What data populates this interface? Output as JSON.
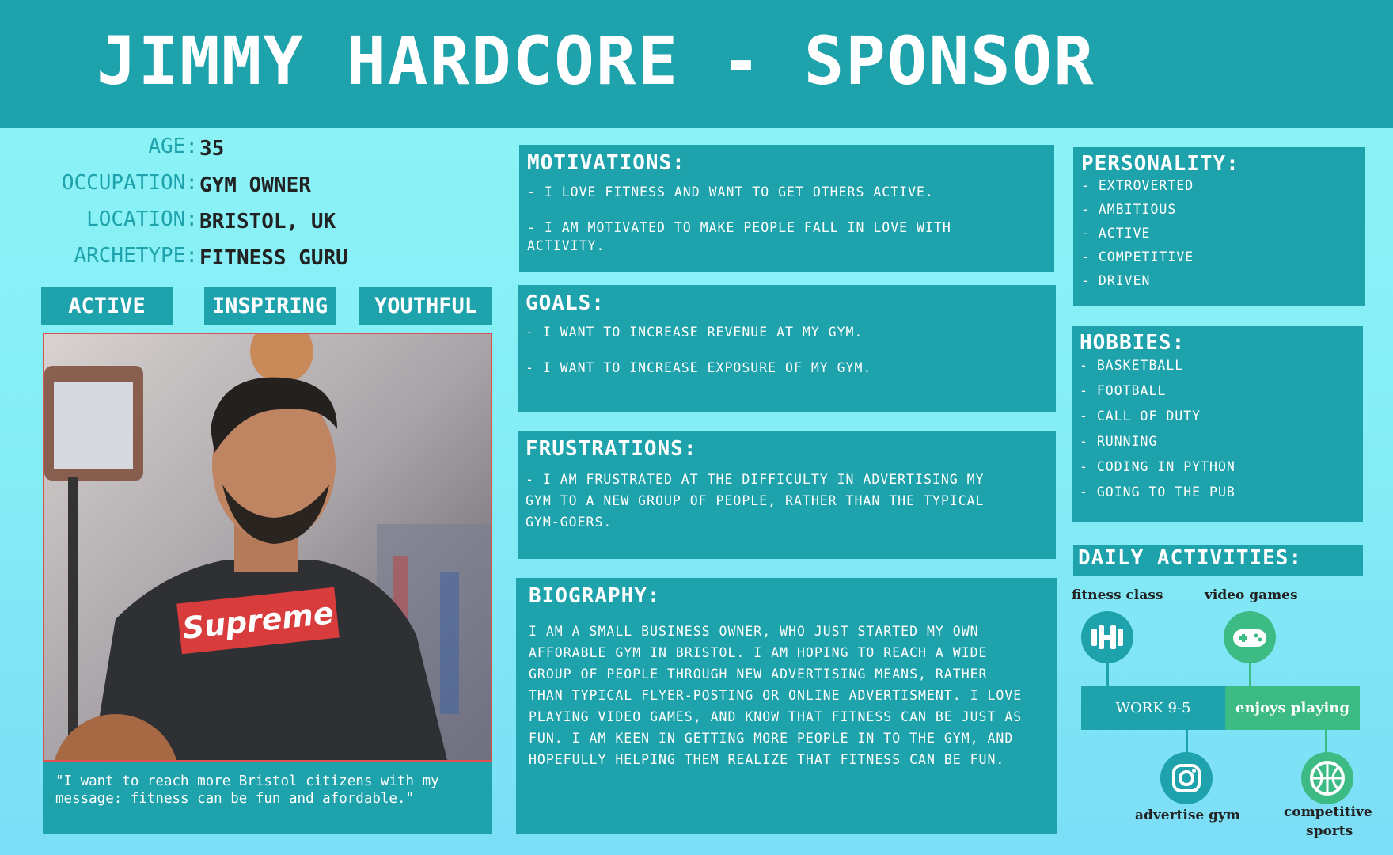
{
  "header": {
    "title": "JIMMY HARDCORE - SPONSOR"
  },
  "demographics": [
    {
      "key": "AGE:",
      "value": "35"
    },
    {
      "key": "OCCUPATION:",
      "value": "GYM OWNER"
    },
    {
      "key": "LOCATION:",
      "value": "BRISTOL, UK"
    },
    {
      "key": "ARCHETYPE:",
      "value": "FITNESS GURU"
    }
  ],
  "traits": [
    "ACTIVE",
    "INSPIRING",
    "YOUTHFUL"
  ],
  "photo": {
    "shirt_text": "Supreme"
  },
  "quote": "\"I want to reach more Bristol citizens with my message: fitness can be fun and afordable.\"",
  "motivations": {
    "title": "MOTIVATIONS:",
    "items": [
      "- I LOVE FITNESS AND WANT TO GET OTHERS ACTIVE.",
      "- I AM MOTIVATED TO MAKE PEOPLE FALL IN LOVE WITH ACTIVITY."
    ]
  },
  "goals": {
    "title": "GOALS:",
    "items": [
      "- I WANT TO INCREASE REVENUE AT MY GYM.",
      "- I WANT TO INCREASE EXPOSURE OF MY GYM."
    ]
  },
  "frustrations": {
    "title": "FRUSTRATIONS:",
    "text": "- I AM FRUSTRATED AT THE DIFFICULTY IN ADVERTISING MY GYM TO A NEW GROUP OF PEOPLE, RATHER THAN THE TYPICAL GYM-GOERS."
  },
  "biography": {
    "title": "BIOGRAPHY:",
    "text": "I AM A SMALL BUSINESS OWNER, WHO JUST STARTED MY OWN AFFORABLE GYM IN BRISTOL. I AM HOPING TO REACH A WIDE GROUP OF PEOPLE THROUGH NEW ADVERTISING MEANS, RATHER THAN TYPICAL FLYER-POSTING OR ONLINE ADVERTISMENT. I LOVE PLAYING VIDEO GAMES, AND KNOW THAT FITNESS CAN BE JUST AS FUN. I AM KEEN IN GETTING MORE PEOPLE IN TO THE GYM, AND HOPEFULLY HELPING THEM REALIZE THAT FITNESS CAN BE FUN."
  },
  "personality": {
    "title": "PERSONALITY:",
    "items": [
      "- EXTROVERTED",
      "- AMBITIOUS",
      "- ACTIVE",
      "- COMPETITIVE",
      "- DRIVEN"
    ]
  },
  "hobbies": {
    "title": "HOBBIES:",
    "items": [
      "- BASKETBALL",
      "- FOOTBALL",
      "- CALL OF DUTY",
      "- RUNNING",
      "- CODING IN PYTHON",
      "- GOING TO THE PUB"
    ]
  },
  "daily": {
    "title": "DAILY ACTIVITIES:",
    "fitness_label": "fitness class",
    "games_label": "video games",
    "work_label": "WORK 9-5",
    "enjoys_label": "enjoys playing",
    "advertise_label": "advertise gym",
    "competitive_label_1": "competitive",
    "competitive_label_2": "sports",
    "dark_teal": "#1ea2ab",
    "green": "#3dbb84"
  },
  "colors": {
    "teal": "#1ea2ab",
    "background": "#8ef5f7",
    "value_text": "#222222"
  }
}
